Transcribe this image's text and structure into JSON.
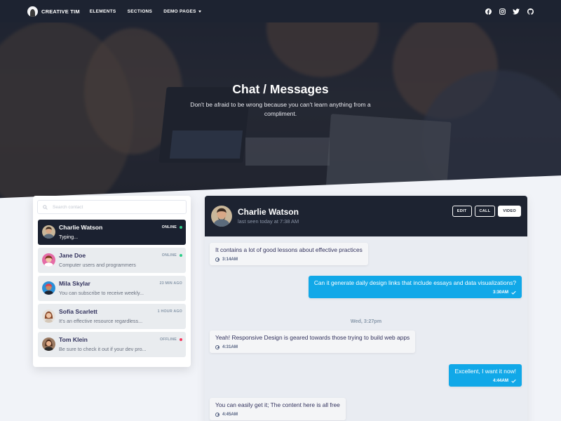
{
  "nav": {
    "brand": "CREATIVE TIM",
    "links": [
      "ELEMENTS",
      "SECTIONS",
      "DEMO PAGES"
    ],
    "social_icons": [
      "facebook-icon",
      "instagram-icon",
      "twitter-icon",
      "github-icon"
    ]
  },
  "hero": {
    "title": "Chat / Messages",
    "subtitle": "Don't be afraid to be wrong because you can't learn anything from a compliment."
  },
  "search": {
    "placeholder": "Search contact"
  },
  "contacts": [
    {
      "name": "Charlie Watson",
      "preview": "Typing...",
      "status": "ONLINE",
      "status_color": "#2dce89",
      "active": true
    },
    {
      "name": "Jane Doe",
      "preview": "Computer users and programmers",
      "status": "ONLINE",
      "status_color": "#2dce89",
      "active": false
    },
    {
      "name": "Mila Skylar",
      "preview": "You can subscribe to receive weekly...",
      "status": "23 MIN AGO",
      "status_color": "",
      "active": false
    },
    {
      "name": "Sofia Scarlett",
      "preview": "It's an effective resource regardless...",
      "status": "1 HOUR AGO",
      "status_color": "",
      "active": false
    },
    {
      "name": "Tom Klein",
      "preview": "Be sure to check it out if your dev pro...",
      "status": "OFFLINE",
      "status_color": "#f5365c",
      "active": false
    }
  ],
  "chat": {
    "name": "Charlie Watson",
    "last_seen": "last seen today at 7:38 AM",
    "buttons": {
      "edit": "EDIT",
      "call": "CALL",
      "video": "VIDEO"
    },
    "date_divider": "Wed, 3:27pm",
    "messages": [
      {
        "dir": "in",
        "text": "It contains a lot of good lessons about effective practices",
        "time": "3:14AM"
      },
      {
        "dir": "out",
        "text": "Can it generate daily design links that include essays and data visualizations?",
        "time": "3:30AM"
      },
      {
        "dir": "in",
        "text": "Yeah! Responsive Design is geared towards those trying to build web apps",
        "time": "4:31AM"
      },
      {
        "dir": "out",
        "text": "Excellent, I want it now!",
        "time": "4:44AM"
      },
      {
        "dir": "in",
        "text": "You can easily get it; The content here is all free",
        "time": "4:45AM"
      }
    ]
  },
  "colors": {
    "navbar": "#1d2331",
    "accent_blue": "#11a8e8",
    "online": "#2dce89",
    "offline": "#f5365c"
  }
}
